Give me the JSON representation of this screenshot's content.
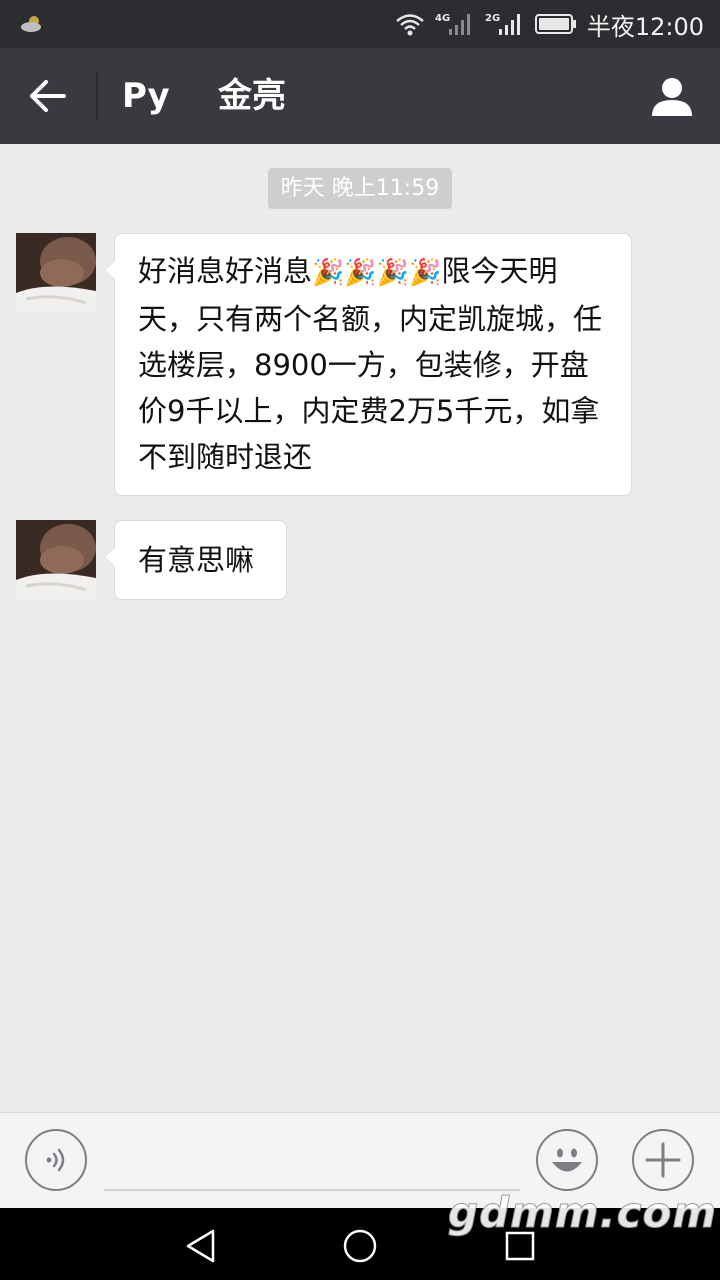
{
  "status_bar": {
    "weather_icon": "cloud-icon",
    "wifi_icon": "wifi-icon",
    "signal_1_label": "4G",
    "signal_2_label": "2G",
    "battery_icon": "battery-icon",
    "time": "半夜12:00"
  },
  "header": {
    "back_icon": "arrow-left-icon",
    "title_prefix": "Py",
    "title_name": "金亮",
    "profile_icon": "person-icon"
  },
  "chat": {
    "timestamp": "昨天 晚上11:59",
    "messages": [
      {
        "avatar_icon": "contact-avatar",
        "text_part_1": "好消息好消息",
        "emoji": "🎉🎉🎉🎉",
        "text_part_2": "限今天明天，只有两个名额，内定凯旋城，任选楼层，8900一方，包装修，开盘价9千以上，内定费2万5千元，如拿不到随时退还"
      },
      {
        "avatar_icon": "contact-avatar",
        "text": "有意思嘛"
      }
    ]
  },
  "input_bar": {
    "voice_icon": "voice-icon",
    "input_value": "",
    "emoji_icon": "smiley-icon",
    "plus_icon": "plus-icon"
  },
  "nav_bar": {
    "back_icon": "triangle-back-icon",
    "home_icon": "circle-home-icon",
    "recent_icon": "square-recent-icon"
  },
  "watermark": "gdmm.com",
  "colors": {
    "status_bar": "#2b2d30",
    "title_bar": "#393a3f",
    "chat_background": "#ebebeb",
    "bubble": "#ffffff",
    "timestamp_bg": "#cecece"
  }
}
